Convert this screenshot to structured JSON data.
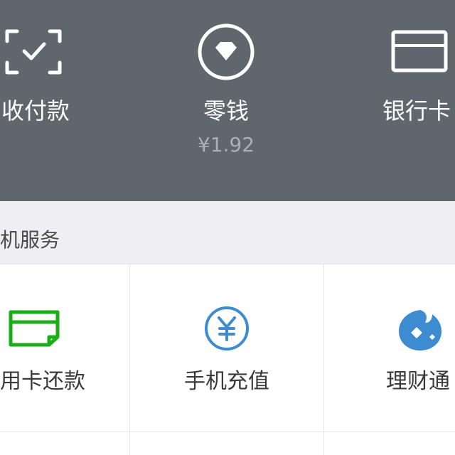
{
  "wallet_header": {
    "items": [
      {
        "label": "收付款",
        "icon": "scan-pay-icon"
      },
      {
        "label": "零钱",
        "sub": "¥1.92",
        "icon": "coin-diamond-icon"
      },
      {
        "label": "银行卡",
        "icon": "bank-card-icon"
      }
    ]
  },
  "section": {
    "title": "机服务"
  },
  "services": [
    {
      "label": "用卡还款",
      "icon": "credit-card-repay-icon",
      "color": "#1aad19"
    },
    {
      "label": "手机充值",
      "icon": "yen-circle-icon",
      "color": "#3d8bd1"
    },
    {
      "label": "理财通",
      "icon": "wealth-fish-icon",
      "color": "#3d8bd1"
    }
  ],
  "colors": {
    "header_bg": "#5f666c",
    "section_bg": "#efeff3",
    "green": "#1aad19",
    "blue": "#3d8bd1"
  }
}
